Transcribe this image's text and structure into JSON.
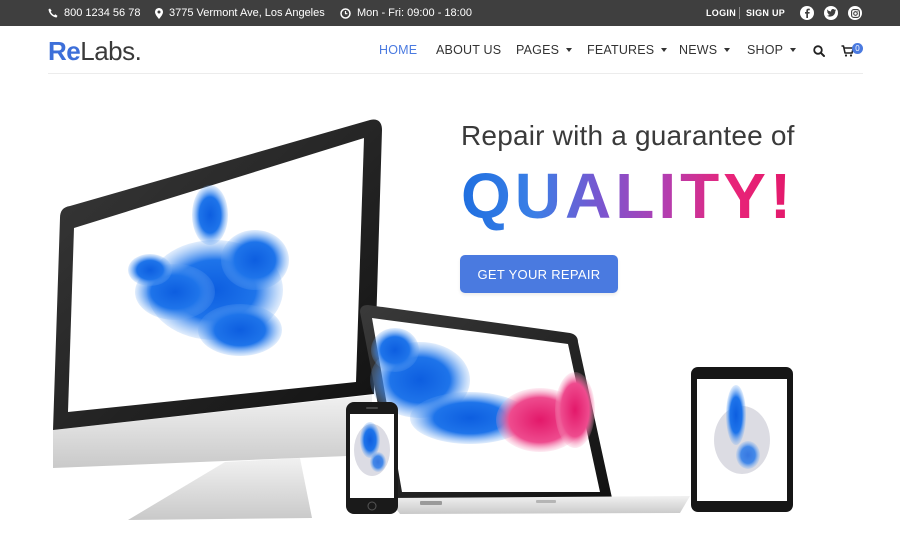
{
  "topbar": {
    "phone": "800 1234 56 78",
    "address": "3775 Vermont Ave, Los Angeles",
    "hours": "Mon - Fri: 09:00 - 18:00",
    "login": "LOGIN",
    "signup": "SIGN UP",
    "social": [
      "facebook-icon",
      "twitter-icon",
      "instagram-icon"
    ]
  },
  "logo": {
    "re": "Re",
    "labs": "Labs",
    "dot": "."
  },
  "nav": {
    "items": [
      {
        "label": "HOME",
        "active": true,
        "dropdown": false
      },
      {
        "label": "ABOUT US",
        "active": false,
        "dropdown": false
      },
      {
        "label": "PAGES",
        "active": false,
        "dropdown": true
      },
      {
        "label": "FEATURES",
        "active": false,
        "dropdown": true
      },
      {
        "label": "NEWS",
        "active": false,
        "dropdown": true
      },
      {
        "label": "SHOP",
        "active": false,
        "dropdown": true
      }
    ],
    "cart_count": "0"
  },
  "hero": {
    "title": "Repair with a guarantee of",
    "highlight": "QUALITY!",
    "cta": "GET YOUR REPAIR"
  },
  "colors": {
    "accent": "#4a7ae0",
    "topbar": "#3f3f3f",
    "gradient_start": "#1f6fe0",
    "gradient_end": "#e3186a"
  }
}
